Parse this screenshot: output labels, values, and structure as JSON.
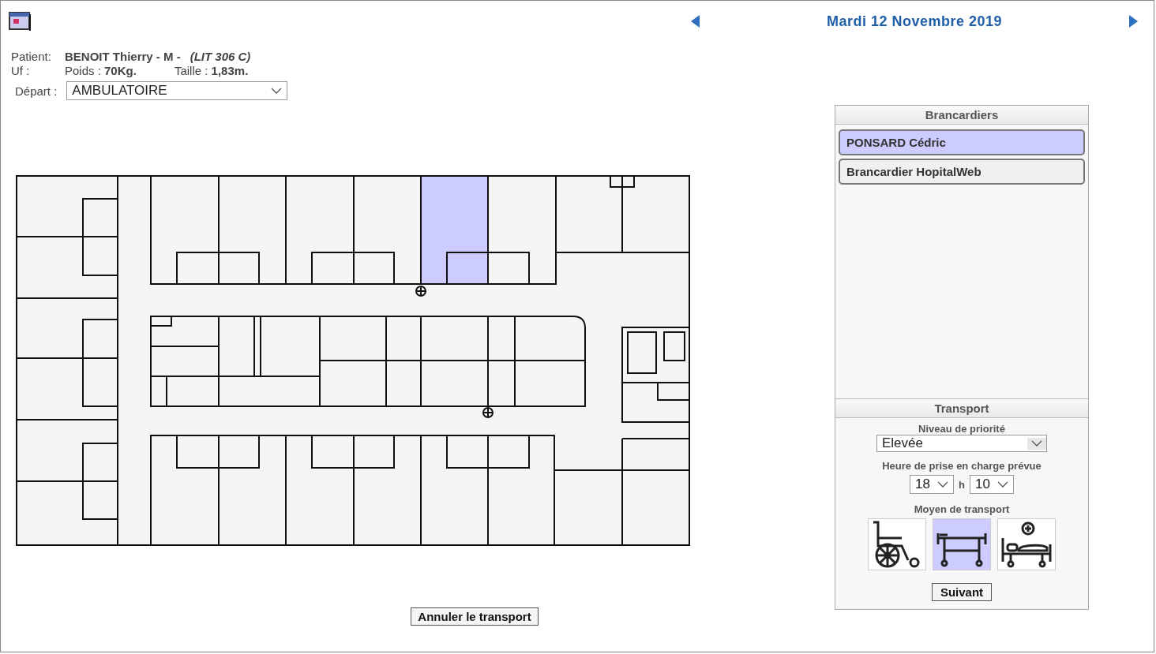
{
  "header": {
    "date": "Mardi 12 Novembre 2019"
  },
  "patient": {
    "label": "Patient:",
    "name": "BENOIT Thierry",
    "sex": "- M -",
    "bed": "(LIT 306 C)",
    "uf_label": "Uf :",
    "weight_label": "Poids :",
    "weight": "70Kg.",
    "height_label": "Taille :",
    "height": "1,83m."
  },
  "departure": {
    "label": "Départ :",
    "value": "AMBULATOIRE"
  },
  "floor_plan": {
    "top_rooms": [
      {
        "selected": false
      },
      {
        "selected": false
      },
      {
        "selected": false
      },
      {
        "selected": false
      },
      {
        "selected": true
      },
      {
        "selected": false
      }
    ]
  },
  "cancel_button": "Annuler le transport",
  "stretcher_bearers": {
    "title": "Brancardiers",
    "items": [
      {
        "name": "PONSARD Cédric",
        "selected": true
      },
      {
        "name": "Brancardier HopitalWeb",
        "selected": false
      }
    ]
  },
  "transport": {
    "title": "Transport",
    "priority_label": "Niveau de priorité",
    "priority": "Elevée",
    "time_label": "Heure de prise en charge prévue",
    "hour": "18",
    "h": "h",
    "minute": "10",
    "means_label": "Moyen de transport",
    "means": [
      {
        "kind": "wheelchair",
        "selected": false
      },
      {
        "kind": "stretcher",
        "selected": true
      },
      {
        "kind": "bed",
        "selected": false
      }
    ],
    "next_button": "Suivant"
  }
}
